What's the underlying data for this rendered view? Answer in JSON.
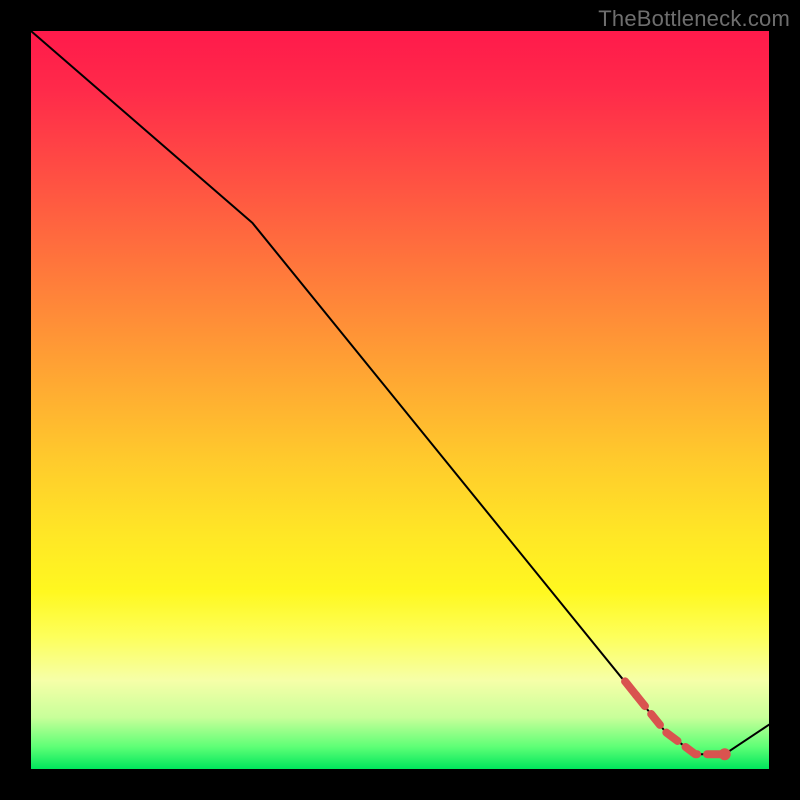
{
  "watermark": "TheBottleneck.com",
  "colors": {
    "line": "#000000",
    "highlight": "#d9534f",
    "frame": "#000000"
  },
  "chart_data": {
    "type": "line",
    "title": "",
    "xlabel": "",
    "ylabel": "",
    "xlim": [
      0,
      100
    ],
    "ylim": [
      0,
      100
    ],
    "grid": false,
    "legend": false,
    "series": [
      {
        "name": "main",
        "x": [
          0,
          30,
          86,
          90,
          94,
          100
        ],
        "y": [
          100,
          74,
          5,
          2,
          2,
          6
        ],
        "style": "solid",
        "color": "#000000"
      },
      {
        "name": "highlight-range",
        "x": [
          82,
          86,
          90,
          94
        ],
        "y": [
          10,
          5,
          2,
          2
        ],
        "style": "dashed",
        "color": "#d9534f"
      }
    ],
    "highlight_point": {
      "x": 94,
      "y": 2
    },
    "notes": "y-values are read in relative units (0 = bottom/green, 100 = top/red); x is horizontal fraction of plot width."
  }
}
